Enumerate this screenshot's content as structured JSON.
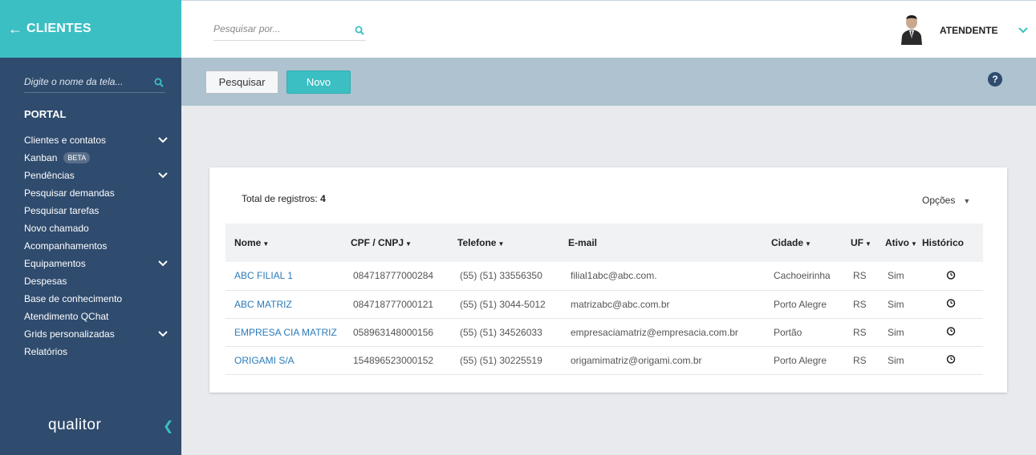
{
  "sidebar": {
    "back_icon": "arrow-left-icon",
    "title": "CLIENTES",
    "search_placeholder": "Digite o nome da tela...",
    "section": "PORTAL",
    "items": [
      {
        "label": "Clientes e contatos",
        "has_chevron": true
      },
      {
        "label": "Kanban",
        "badge": "BETA"
      },
      {
        "label": "Pendências",
        "has_chevron": true
      },
      {
        "label": "Pesquisar demandas"
      },
      {
        "label": "Pesquisar tarefas"
      },
      {
        "label": "Novo chamado"
      },
      {
        "label": "Acompanhamentos"
      },
      {
        "label": "Equipamentos",
        "has_chevron": true
      },
      {
        "label": "Despesas"
      },
      {
        "label": "Base de conhecimento"
      },
      {
        "label": "Atendimento QChat"
      },
      {
        "label": "Grids personalizadas",
        "has_chevron": true
      },
      {
        "label": "Relatórios"
      }
    ],
    "logo": "qualitor",
    "collapse_icon": "chevron-left-icon"
  },
  "topbar": {
    "search_placeholder": "Pesquisar por...",
    "user": "ATENDENTE"
  },
  "toolbar": {
    "pesquisar_label": "Pesquisar",
    "novo_label": "Novo",
    "help_label": "?"
  },
  "results": {
    "total_label": "Total de registros:",
    "total_value": "4",
    "options_label": "Opções",
    "columns": [
      "Nome",
      "CPF / CNPJ",
      "Telefone",
      "E-mail",
      "Cidade",
      "UF",
      "Ativo",
      "Histórico"
    ],
    "rows": [
      {
        "nome": "ABC FILIAL 1",
        "cpf": "084718777000284",
        "telefone": "(55) (51) 33556350",
        "email": "filial1abc@abc.com.",
        "cidade": "Cachoeirinha",
        "uf": "RS",
        "ativo": "Sim"
      },
      {
        "nome": "ABC MATRIZ",
        "cpf": "084718777000121",
        "telefone": "(55) (51) 3044-5012",
        "email": "matrizabc@abc.com.br",
        "cidade": "Porto Alegre",
        "uf": "RS",
        "ativo": "Sim"
      },
      {
        "nome": "EMPRESA CIA MATRIZ",
        "cpf": "058963148000156",
        "telefone": "(55) (51) 34526033",
        "email": "empresaciamatriz@empresacia.com.br",
        "cidade": "Portão",
        "uf": "RS",
        "ativo": "Sim"
      },
      {
        "nome": "ORIGAMI S/A",
        "cpf": "154896523000152",
        "telefone": "(55) (51) 30225519",
        "email": "origamimatriz@origami.com.br",
        "cidade": "Porto Alegre",
        "uf": "RS",
        "ativo": "Sim"
      }
    ]
  },
  "colors": {
    "accent": "#3bbfc3",
    "sidebar": "#2f4b6e",
    "toolbar": "#aec2d0",
    "link": "#2b7bb9"
  }
}
